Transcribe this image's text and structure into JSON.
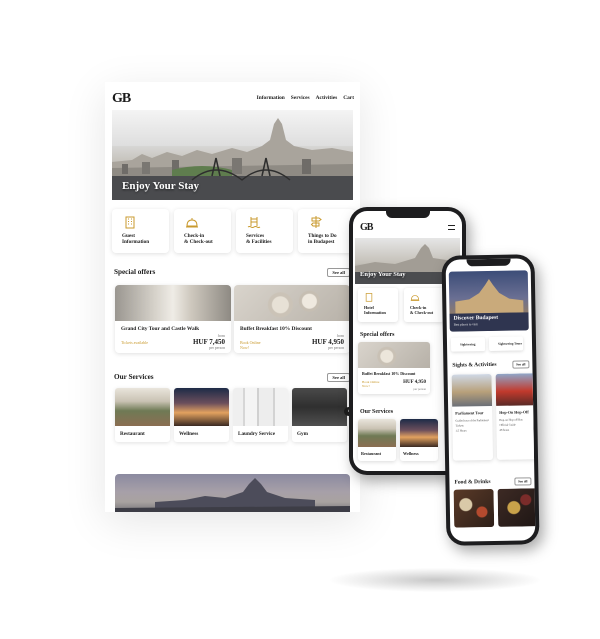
{
  "tablet": {
    "logo": "GB",
    "nav": [
      "Information",
      "Services",
      "Activities",
      "Cart"
    ],
    "hero_title": "Enjoy Your Stay",
    "info_cards": [
      {
        "label": "Guest\nInformation",
        "icon": "building-icon"
      },
      {
        "label": "Check-in\n& Check-out",
        "icon": "reception-bell-icon"
      },
      {
        "label": "Services\n& Facilities",
        "icon": "pool-icon"
      },
      {
        "label": "Things to Do\nin Budapest",
        "icon": "signpost-icon"
      }
    ],
    "special_offers": {
      "title": "Special offers",
      "see_all": "See all",
      "items": [
        {
          "title": "Grand City Tour and Castle Walk",
          "label": "Tickets available",
          "from": "from",
          "price": "HUF 7,450",
          "per": "per person"
        },
        {
          "title": "Buffet Breakfast 10% Discount",
          "label": "Book Online Now!",
          "from": "from",
          "price": "HUF 4,950",
          "per": "per person"
        }
      ]
    },
    "services": {
      "title": "Our Services",
      "see_all": "See all",
      "items": [
        "Restaurant",
        "Wellness",
        "Laundry Service",
        "Gym"
      ]
    }
  },
  "phone1": {
    "logo": "GB",
    "hero_title": "Enjoy Your Stay",
    "info_cards": [
      "Hotel\nInformation",
      "Check-in\n& Check-out"
    ],
    "offers_title": "Special offers",
    "offer": {
      "title": "Buffet Breakfast 10% Discount",
      "label": "Book Online Now!",
      "price": "HUF 4,950",
      "per": "per person"
    },
    "services_title": "Our Services",
    "services": [
      "Restaurant",
      "Wellness"
    ]
  },
  "phone2": {
    "hero_title": "Discover Budapest",
    "hero_sub": "Best places to visit",
    "chips": [
      "Sightseeing",
      "Sightseeing Tours"
    ],
    "section1_title": "Sights & Activities",
    "section1_see_all": "See all",
    "tour1": {
      "title": "Parliament Tour",
      "bullets": [
        "Guided tour of the Parliament",
        "Tickets",
        "1,5 Hours"
      ]
    },
    "tour2": {
      "title": "Hop-On Hop-Off",
      "bullets": [
        "Hop-on Hop-off Bus",
        "Official Guide",
        "48 hours"
      ]
    },
    "section2_title": "Food & Drinks",
    "section2_see_all": "See all"
  },
  "colors": {
    "accent": "#c99a2e",
    "text": "#1b1b1b",
    "phone_body": "#1d1d1f"
  }
}
